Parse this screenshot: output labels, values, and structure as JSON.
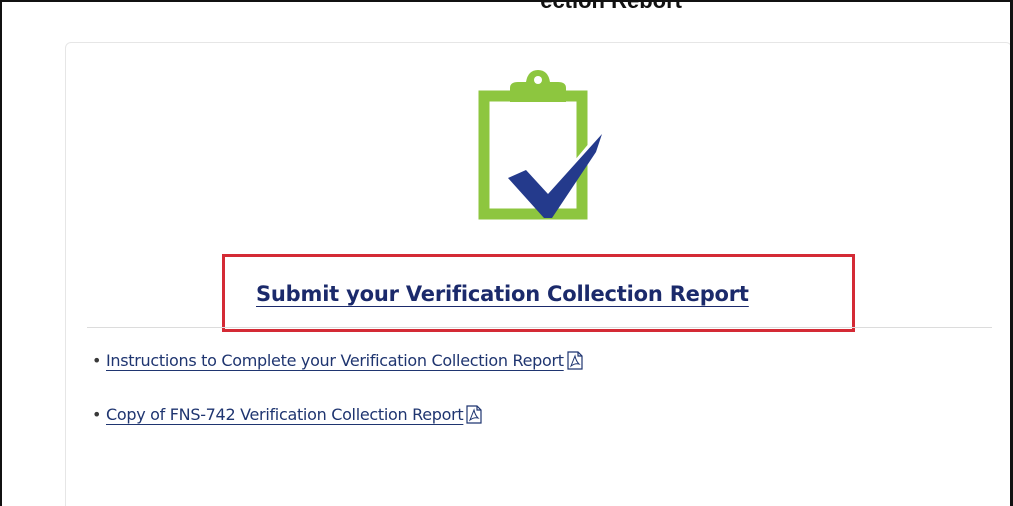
{
  "header": {
    "cut_off_title": "ection Report"
  },
  "card": {
    "icon": "clipboard-check-icon",
    "title_link": "Submit your Verification Collection Report",
    "documents": [
      {
        "label": "Instructions to Complete your Verification Collection Report",
        "icon": "pdf-icon"
      },
      {
        "label": "Copy of FNS-742 Verification Collection Report",
        "icon": "pdf-icon"
      }
    ]
  },
  "colors": {
    "clipboard_green": "#8dc63f",
    "check_navy": "#243a8c",
    "title_navy": "#1b2a6b",
    "highlight_red": "#d42a35"
  }
}
